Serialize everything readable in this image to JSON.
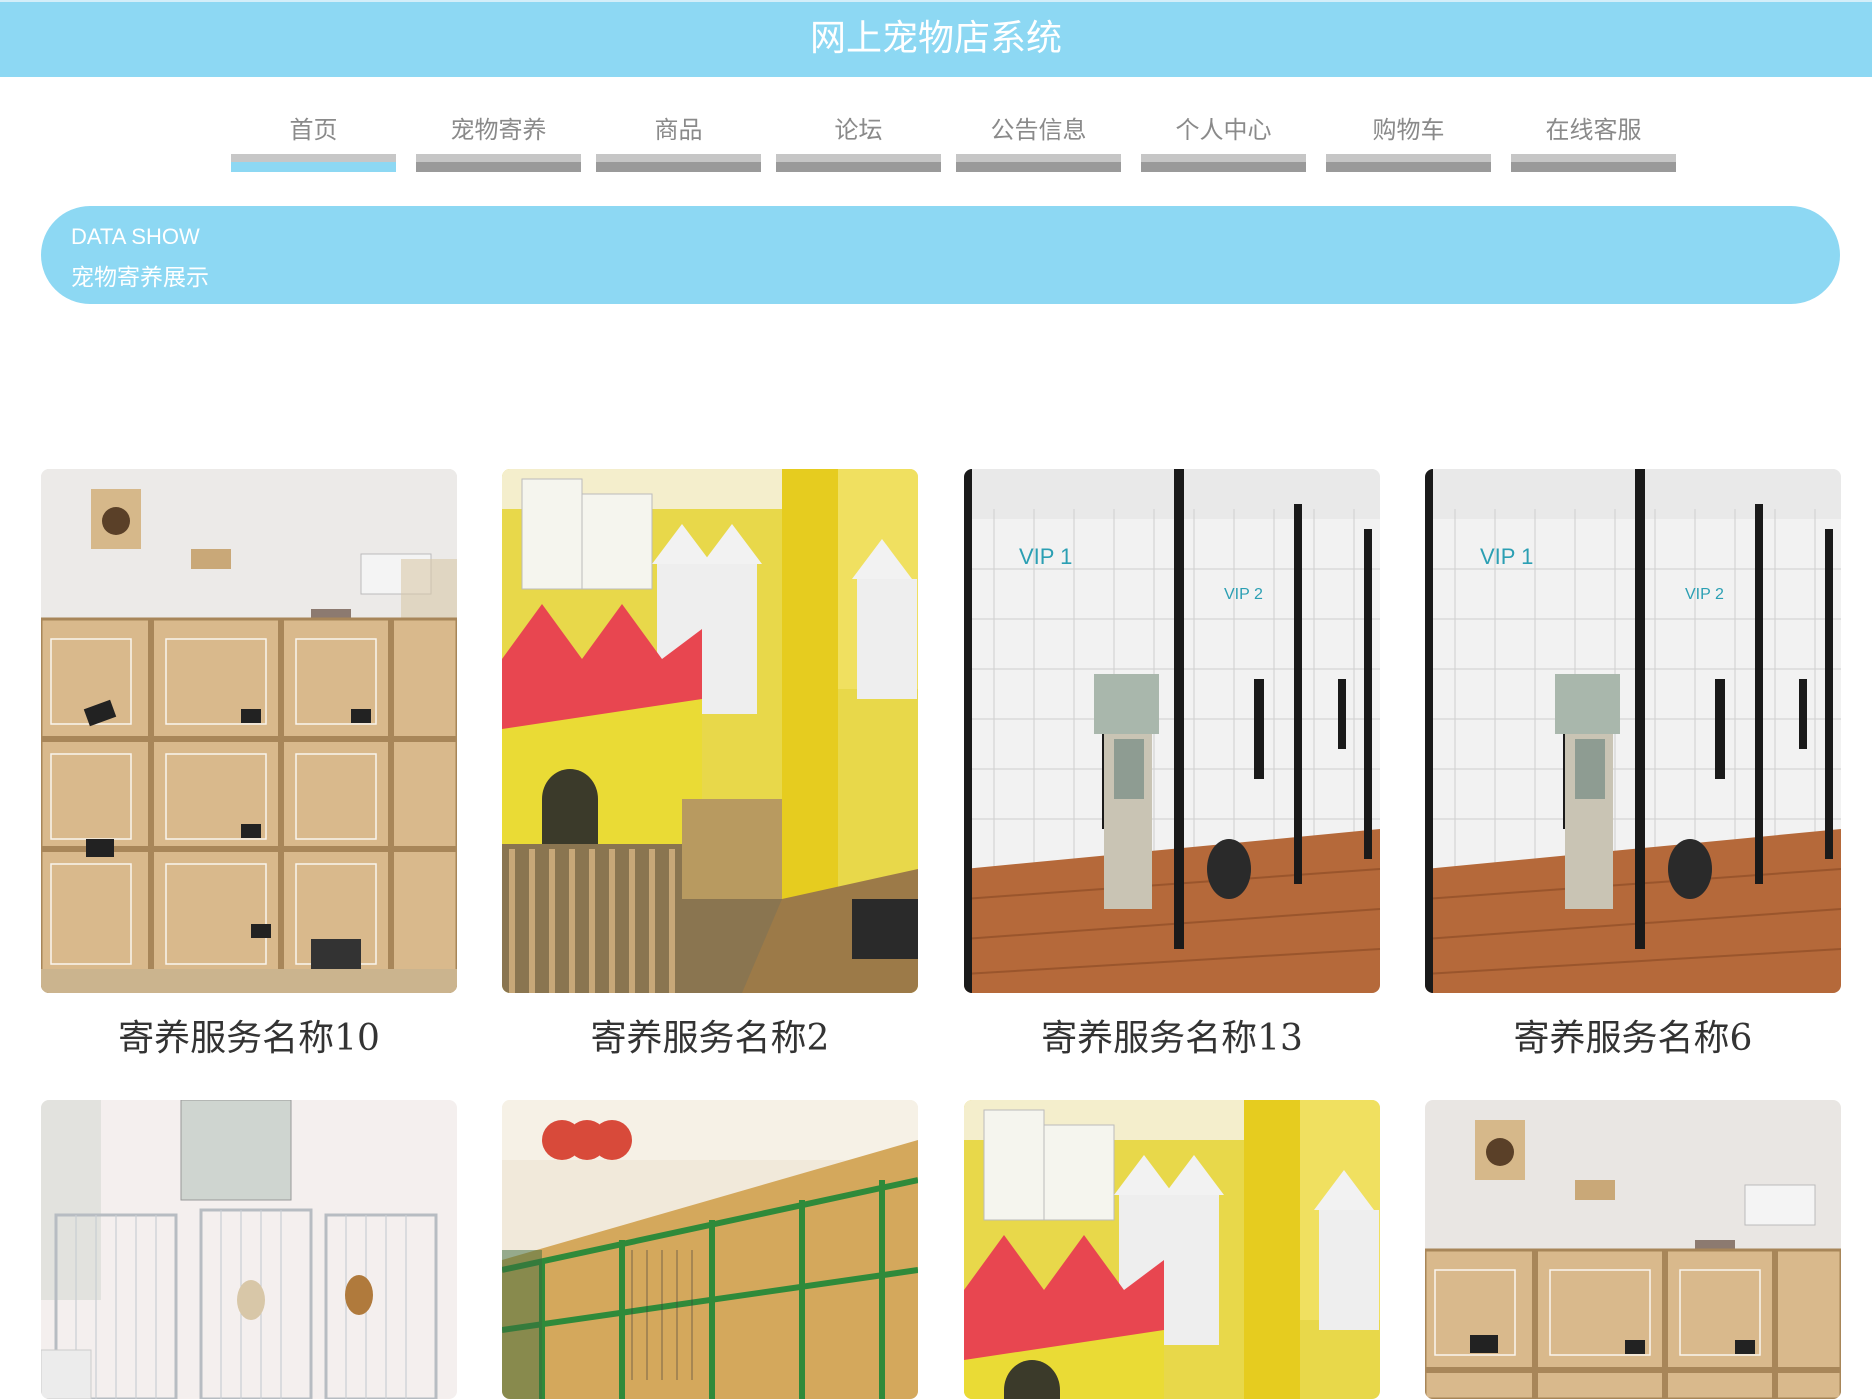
{
  "header": {
    "title": "网上宠物店系统"
  },
  "nav": {
    "items": [
      {
        "label": "首页"
      },
      {
        "label": "宠物寄养"
      },
      {
        "label": "商品"
      },
      {
        "label": "论坛"
      },
      {
        "label": "公告信息"
      },
      {
        "label": "个人中心"
      },
      {
        "label": "购物车"
      },
      {
        "label": "在线客服"
      }
    ],
    "active_index": 0
  },
  "banner": {
    "en": "DATA SHOW",
    "cn": "宠物寄养展示"
  },
  "colors": {
    "accent": "#8dd8f3",
    "nav_text": "#8a8a8a",
    "nav_bar": "#9a9a9a",
    "card_title": "#333333"
  },
  "cards": [
    {
      "title": "寄养服务名称10",
      "image": "wooden-cat-cabinets"
    },
    {
      "title": "寄养服务名称2",
      "image": "yellow-dog-kennel-houses"
    },
    {
      "title": "寄养服务名称13",
      "image": "vip-glass-cat-rooms"
    },
    {
      "title": "寄养服务名称6",
      "image": "vip-glass-cat-rooms"
    },
    {
      "title": "",
      "image": "metal-dog-cages"
    },
    {
      "title": "",
      "image": "green-fence-kennel"
    },
    {
      "title": "",
      "image": "yellow-dog-kennel-houses"
    },
    {
      "title": "",
      "image": "wooden-cat-cabinets"
    }
  ]
}
